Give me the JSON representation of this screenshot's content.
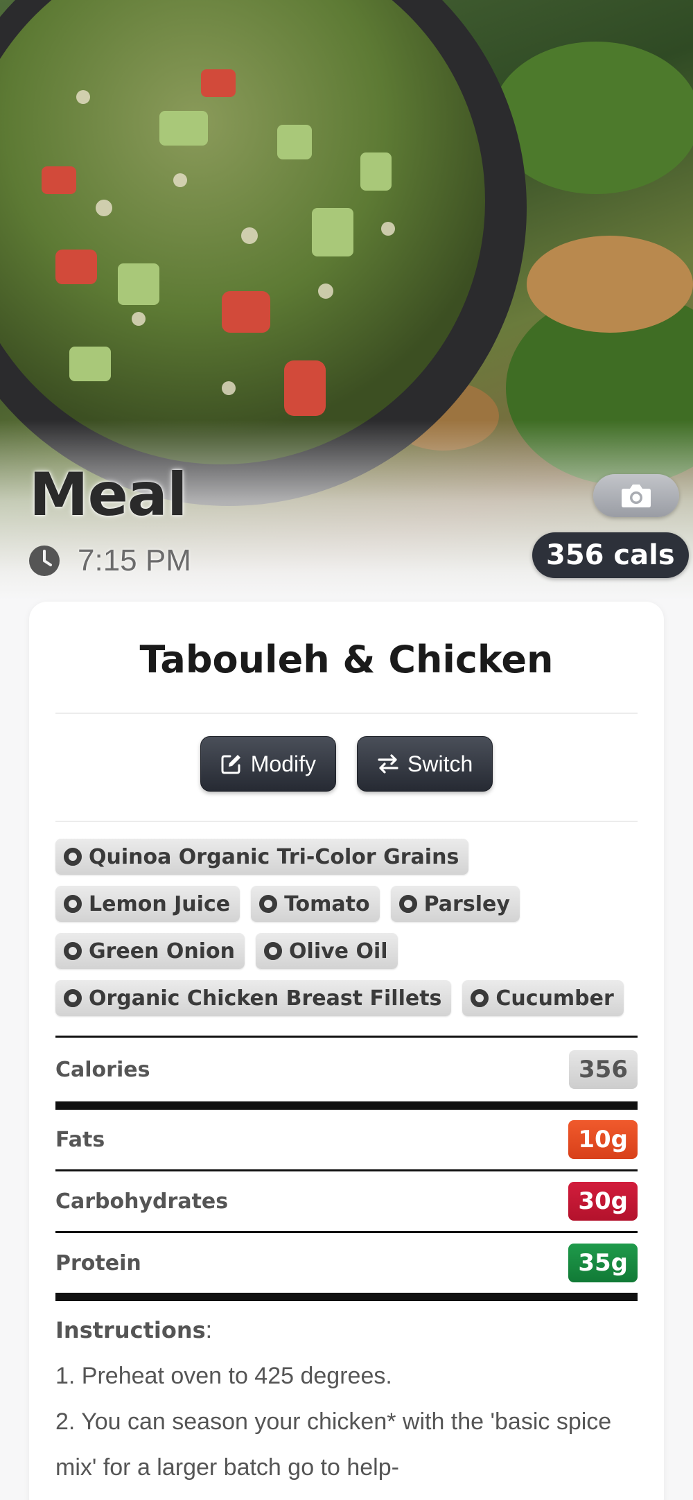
{
  "hero": {
    "meal_label": "Meal",
    "time": "7:15 PM",
    "calories_badge": "356 cals",
    "camera_icon": "camera-icon",
    "clock_icon": "clock-icon"
  },
  "recipe": {
    "title": "Tabouleh & Chicken",
    "actions": [
      {
        "label": "Modify",
        "icon": "edit-icon"
      },
      {
        "label": "Switch",
        "icon": "swap-arrows-icon"
      }
    ],
    "ingredients": [
      "Quinoa Organic Tri-Color Grains",
      "Lemon Juice",
      "Tomato",
      "Parsley",
      "Green Onion",
      "Olive Oil",
      "Organic Chicken Breast Fillets",
      "Cucumber"
    ]
  },
  "nutrition": {
    "calories": {
      "label": "Calories",
      "value": "356"
    },
    "fats": {
      "label": "Fats",
      "value": "10g",
      "color": "#e54b24"
    },
    "carbs": {
      "label": "Carbohydrates",
      "value": "30g",
      "color": "#c4172f"
    },
    "protein": {
      "label": "Protein",
      "value": "35g",
      "color": "#178a41"
    }
  },
  "instructions": {
    "heading": "Instructions",
    "steps": [
      "1. Preheat oven to 425 degrees.",
      "2. You can season your chicken* with the 'basic spice mix' for a larger batch go to help-"
    ]
  }
}
